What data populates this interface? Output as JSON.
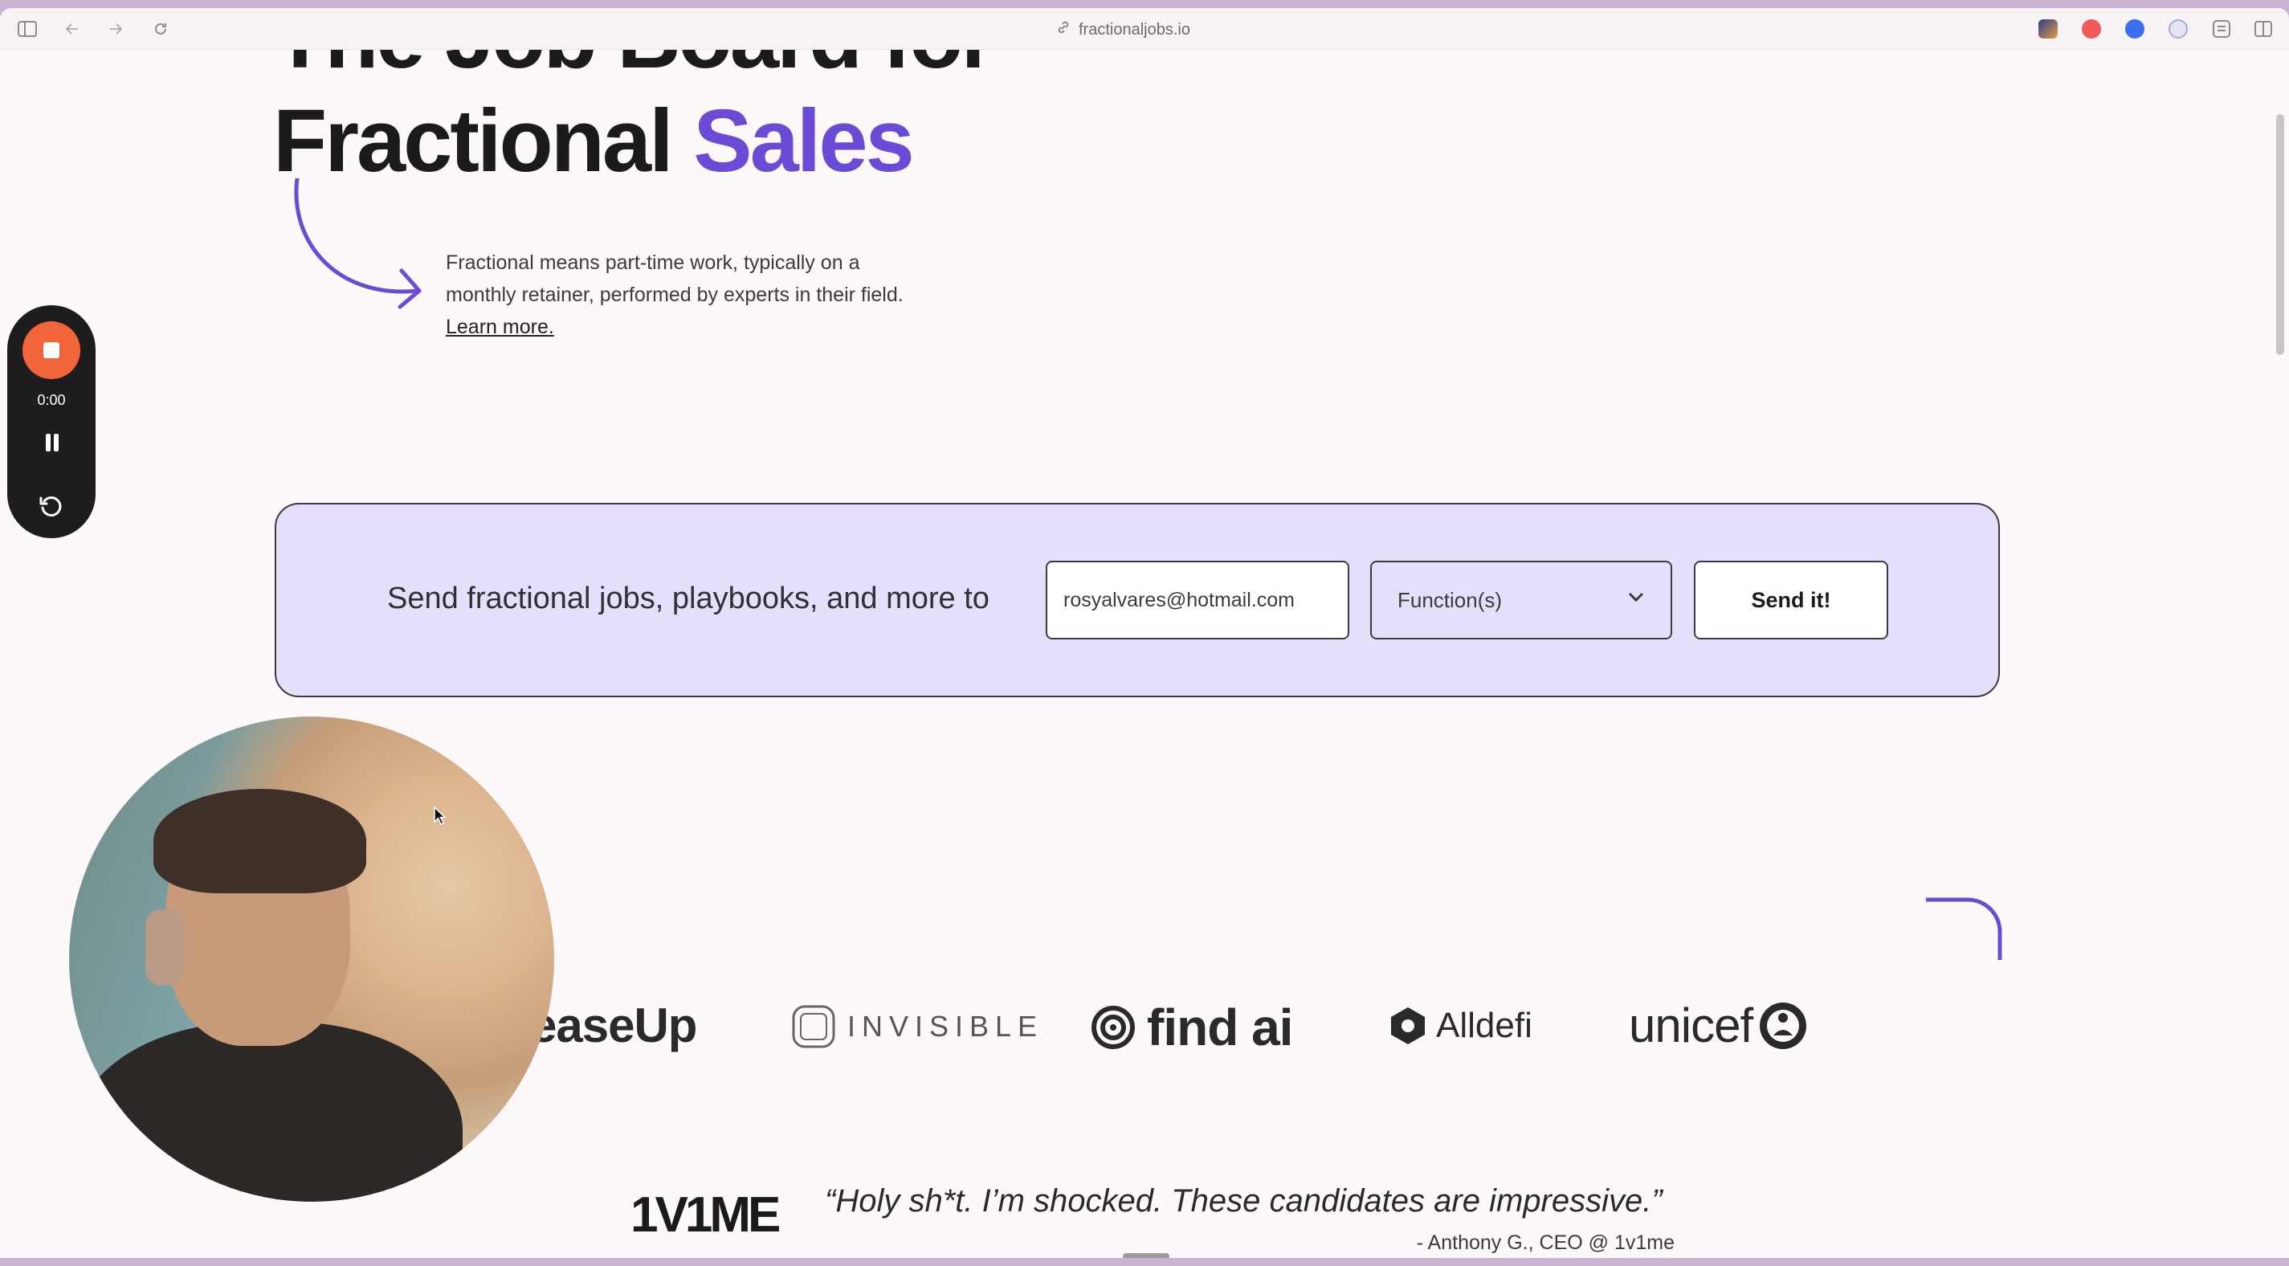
{
  "browser": {
    "url": "fractionaljobs.io"
  },
  "hero": {
    "title_line1": "The Job Board for",
    "title_line2_prefix": "Fractional",
    "title_line2_accent": "Sales",
    "description": "Fractional means part-time work, typically on a monthly retainer, performed by experts in their field.",
    "learn_more": "Learn more."
  },
  "recorder": {
    "time": "0:00"
  },
  "signup": {
    "text": "Send fractional jobs, playbooks, and more to",
    "email_value": "rosyalvares@hotmail.com",
    "function_selected": "Function(s)",
    "send_label": "Send it!"
  },
  "logos": {
    "leaseup": "easeUp",
    "invisible": "INVISIBLE",
    "findai": "find ai",
    "alldefi": "Alldefi",
    "unicef": "unicef"
  },
  "testimonial": {
    "brand": "1V1ME",
    "quote": "“Holy sh*t. I’m shocked. These candidates are impressive.”",
    "author": "- Anthony G., CEO @ 1v1me"
  },
  "colors": {
    "accent": "#6b4bd6",
    "signup_bg": "#e6dffb",
    "record": "#f2643a"
  }
}
